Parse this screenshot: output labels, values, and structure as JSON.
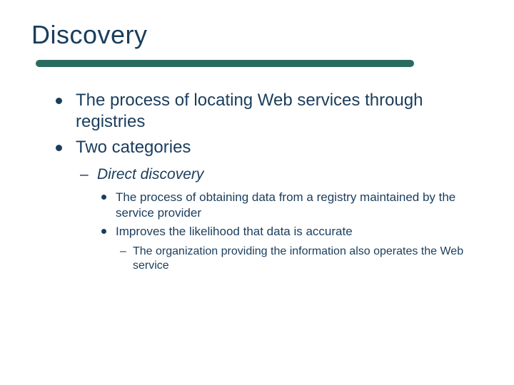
{
  "title": "Discovery",
  "bullets": {
    "b1": "The process of locating Web services through registries",
    "b2": "Two categories",
    "b2_1": "Direct discovery",
    "b2_1_1": "The process of obtaining data from a registry maintained by the service provider",
    "b2_1_2": "Improves the likelihood that data is accurate",
    "b2_1_2_1": "The organization providing the information also operates the Web service"
  }
}
